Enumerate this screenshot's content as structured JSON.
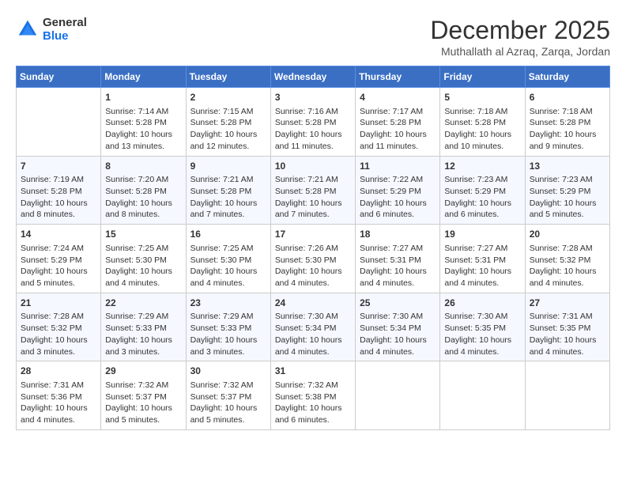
{
  "header": {
    "logo_line1": "General",
    "logo_line2": "Blue",
    "month": "December 2025",
    "location": "Muthallath al Azraq, Zarqa, Jordan"
  },
  "days_of_week": [
    "Sunday",
    "Monday",
    "Tuesday",
    "Wednesday",
    "Thursday",
    "Friday",
    "Saturday"
  ],
  "weeks": [
    [
      {
        "day": "",
        "info": ""
      },
      {
        "day": "1",
        "info": "Sunrise: 7:14 AM\nSunset: 5:28 PM\nDaylight: 10 hours\nand 13 minutes."
      },
      {
        "day": "2",
        "info": "Sunrise: 7:15 AM\nSunset: 5:28 PM\nDaylight: 10 hours\nand 12 minutes."
      },
      {
        "day": "3",
        "info": "Sunrise: 7:16 AM\nSunset: 5:28 PM\nDaylight: 10 hours\nand 11 minutes."
      },
      {
        "day": "4",
        "info": "Sunrise: 7:17 AM\nSunset: 5:28 PM\nDaylight: 10 hours\nand 11 minutes."
      },
      {
        "day": "5",
        "info": "Sunrise: 7:18 AM\nSunset: 5:28 PM\nDaylight: 10 hours\nand 10 minutes."
      },
      {
        "day": "6",
        "info": "Sunrise: 7:18 AM\nSunset: 5:28 PM\nDaylight: 10 hours\nand 9 minutes."
      }
    ],
    [
      {
        "day": "7",
        "info": "Sunrise: 7:19 AM\nSunset: 5:28 PM\nDaylight: 10 hours\nand 8 minutes."
      },
      {
        "day": "8",
        "info": "Sunrise: 7:20 AM\nSunset: 5:28 PM\nDaylight: 10 hours\nand 8 minutes."
      },
      {
        "day": "9",
        "info": "Sunrise: 7:21 AM\nSunset: 5:28 PM\nDaylight: 10 hours\nand 7 minutes."
      },
      {
        "day": "10",
        "info": "Sunrise: 7:21 AM\nSunset: 5:28 PM\nDaylight: 10 hours\nand 7 minutes."
      },
      {
        "day": "11",
        "info": "Sunrise: 7:22 AM\nSunset: 5:29 PM\nDaylight: 10 hours\nand 6 minutes."
      },
      {
        "day": "12",
        "info": "Sunrise: 7:23 AM\nSunset: 5:29 PM\nDaylight: 10 hours\nand 6 minutes."
      },
      {
        "day": "13",
        "info": "Sunrise: 7:23 AM\nSunset: 5:29 PM\nDaylight: 10 hours\nand 5 minutes."
      }
    ],
    [
      {
        "day": "14",
        "info": "Sunrise: 7:24 AM\nSunset: 5:29 PM\nDaylight: 10 hours\nand 5 minutes."
      },
      {
        "day": "15",
        "info": "Sunrise: 7:25 AM\nSunset: 5:30 PM\nDaylight: 10 hours\nand 4 minutes."
      },
      {
        "day": "16",
        "info": "Sunrise: 7:25 AM\nSunset: 5:30 PM\nDaylight: 10 hours\nand 4 minutes."
      },
      {
        "day": "17",
        "info": "Sunrise: 7:26 AM\nSunset: 5:30 PM\nDaylight: 10 hours\nand 4 minutes."
      },
      {
        "day": "18",
        "info": "Sunrise: 7:27 AM\nSunset: 5:31 PM\nDaylight: 10 hours\nand 4 minutes."
      },
      {
        "day": "19",
        "info": "Sunrise: 7:27 AM\nSunset: 5:31 PM\nDaylight: 10 hours\nand 4 minutes."
      },
      {
        "day": "20",
        "info": "Sunrise: 7:28 AM\nSunset: 5:32 PM\nDaylight: 10 hours\nand 4 minutes."
      }
    ],
    [
      {
        "day": "21",
        "info": "Sunrise: 7:28 AM\nSunset: 5:32 PM\nDaylight: 10 hours\nand 3 minutes."
      },
      {
        "day": "22",
        "info": "Sunrise: 7:29 AM\nSunset: 5:33 PM\nDaylight: 10 hours\nand 3 minutes."
      },
      {
        "day": "23",
        "info": "Sunrise: 7:29 AM\nSunset: 5:33 PM\nDaylight: 10 hours\nand 3 minutes."
      },
      {
        "day": "24",
        "info": "Sunrise: 7:30 AM\nSunset: 5:34 PM\nDaylight: 10 hours\nand 4 minutes."
      },
      {
        "day": "25",
        "info": "Sunrise: 7:30 AM\nSunset: 5:34 PM\nDaylight: 10 hours\nand 4 minutes."
      },
      {
        "day": "26",
        "info": "Sunrise: 7:30 AM\nSunset: 5:35 PM\nDaylight: 10 hours\nand 4 minutes."
      },
      {
        "day": "27",
        "info": "Sunrise: 7:31 AM\nSunset: 5:35 PM\nDaylight: 10 hours\nand 4 minutes."
      }
    ],
    [
      {
        "day": "28",
        "info": "Sunrise: 7:31 AM\nSunset: 5:36 PM\nDaylight: 10 hours\nand 4 minutes."
      },
      {
        "day": "29",
        "info": "Sunrise: 7:32 AM\nSunset: 5:37 PM\nDaylight: 10 hours\nand 5 minutes."
      },
      {
        "day": "30",
        "info": "Sunrise: 7:32 AM\nSunset: 5:37 PM\nDaylight: 10 hours\nand 5 minutes."
      },
      {
        "day": "31",
        "info": "Sunrise: 7:32 AM\nSunset: 5:38 PM\nDaylight: 10 hours\nand 6 minutes."
      },
      {
        "day": "",
        "info": ""
      },
      {
        "day": "",
        "info": ""
      },
      {
        "day": "",
        "info": ""
      }
    ]
  ]
}
